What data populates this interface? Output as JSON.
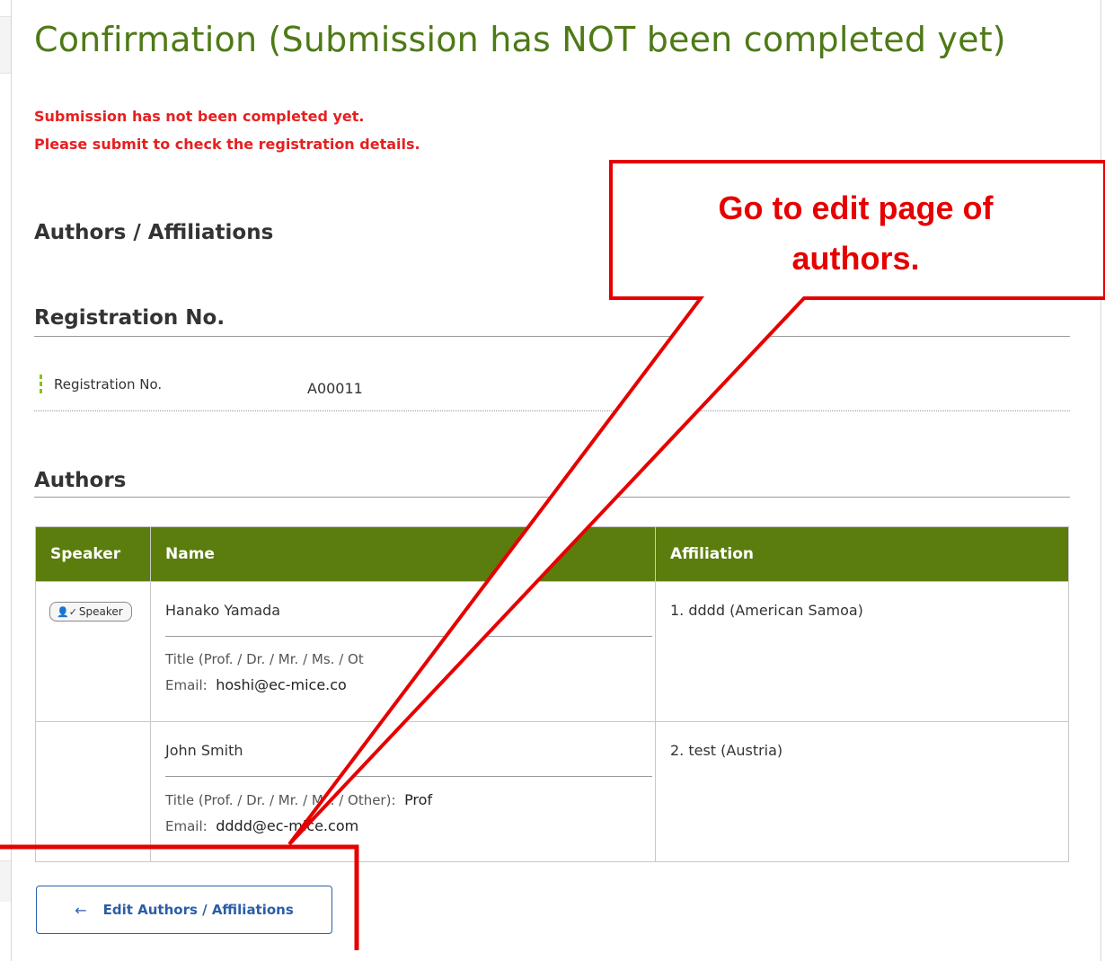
{
  "page": {
    "title": "Confirmation (Submission has NOT been completed yet)",
    "warning_line1": "Submission has not been completed yet.",
    "warning_line2": "Please submit to check the registration details.",
    "section_title": "Authors / Affiliations"
  },
  "registration": {
    "heading": "Registration No.",
    "label": "Registration No.",
    "value": "A00011"
  },
  "authors": {
    "heading": "Authors",
    "columns": [
      "Speaker",
      "Name",
      "Affiliation"
    ],
    "title_label": "Title (Prof. / Dr. / Mr. / Ms. / Other):",
    "email_label": "Email:",
    "rows": [
      {
        "speaker_badge": "Speaker",
        "name": "Hanako Yamada",
        "title_label_visible": "Title (Prof. / Dr. / Mr. / Ms. / Ot",
        "title_value": "",
        "email_visible": "hoshi@ec-mice.co",
        "affiliation": "1. dddd (American Samoa)"
      },
      {
        "speaker_badge": "",
        "name": "John Smith",
        "title_label_visible": "Title (Prof. / Dr. / Mr. / Ms. / Other):",
        "title_value": "Prof",
        "email_visible": "dddd@ec-mice.com",
        "affiliation": "2. test (Austria)"
      }
    ]
  },
  "actions": {
    "edit_button_label": "Edit Authors / Affiliations",
    "edit_button_icon": "arrow-left-icon"
  },
  "annotation": {
    "line1": "Go to edit page of",
    "line2": "authors."
  },
  "colors": {
    "title_green": "#4e7a16",
    "header_green": "#5b7d0e",
    "warning_red": "#e62020",
    "callout_red": "#e60000",
    "button_blue": "#2a5ea8"
  }
}
